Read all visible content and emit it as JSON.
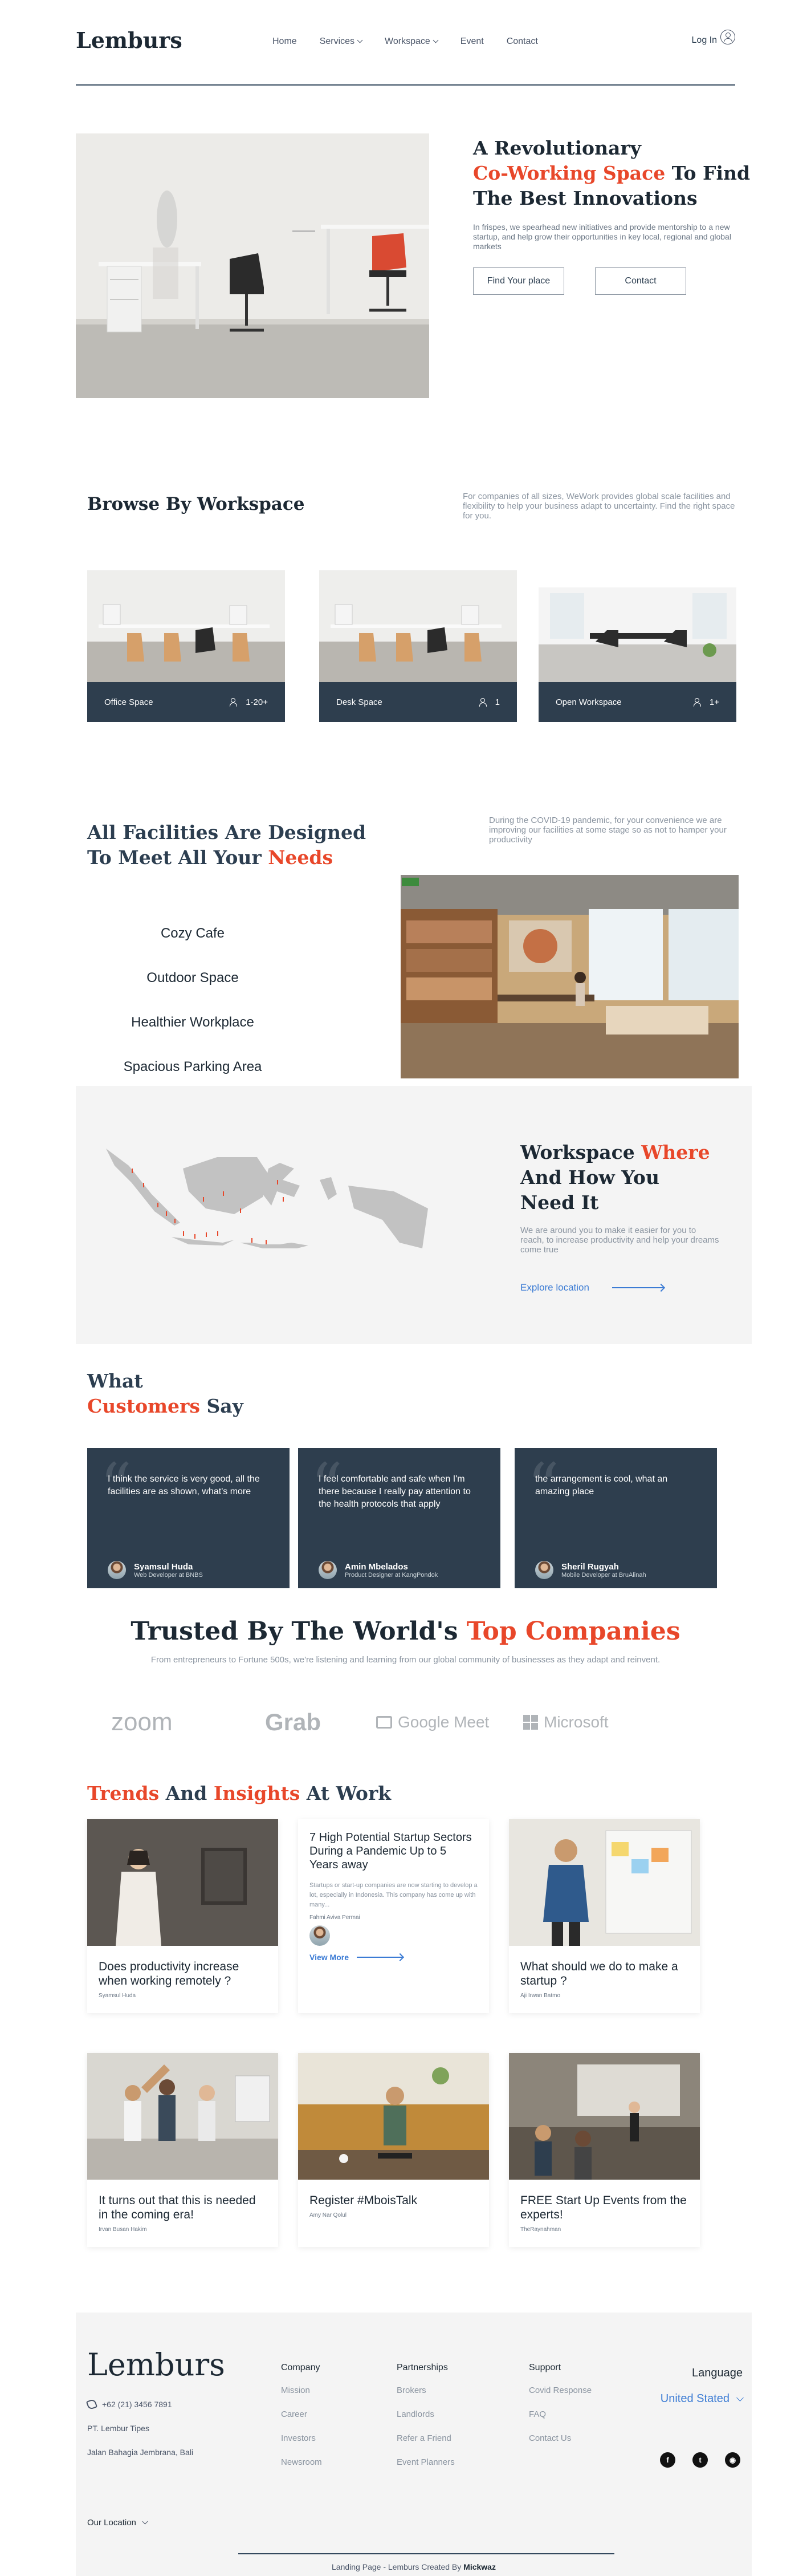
{
  "nav": {
    "logo": "Lemburs",
    "items": [
      "Home",
      "Services",
      "Workspace",
      "Event",
      "Contact"
    ],
    "login": "Log In"
  },
  "hero": {
    "title_1": "A Revolutionary",
    "title_accent": "Co-Working Space",
    "title_2": " To Find The Best Innovations",
    "subtitle": "In frispes, we spearhead new initiatives and provide mentorship to a new startup, and help grow their opportunities in key local, regional and global markets",
    "btn_primary": "Find Your place",
    "btn_secondary": "Contact"
  },
  "browse": {
    "title": "Browse By Workspace",
    "description": "For companies of all sizes, WeWork provides global scale facilities and flexibility to help your business adapt to uncertainty. Find the right space for you.",
    "cards": [
      {
        "name": "Office Space",
        "capacity": "1-20+"
      },
      {
        "name": "Desk Space",
        "capacity": "1"
      },
      {
        "name": "Open Workspace",
        "capacity": "1+"
      }
    ]
  },
  "facilities": {
    "title_1": "All Facilities Are Designed To Meet All Your ",
    "title_accent": "Needs",
    "description": "During the COVID-19 pandemic, for your convenience we are improving our facilities at some stage so as not to hamper your productivity",
    "items": [
      "Cozy Cafe",
      "Outdoor Space",
      "Healthier Workplace",
      "Spacious Parking Area"
    ]
  },
  "map": {
    "title_1": "Workspace ",
    "title_accent": "Where",
    "title_2": " And How You Need It",
    "subtitle": "We are around you to make it easier for you to reach, to increase productivity and help your dreams come true",
    "link": "Explore location"
  },
  "customers": {
    "title_1": "What",
    "title_accent": "Customers",
    "title_2": " Say",
    "testimonials": [
      {
        "quote": "I think the service is very good, all the facilities are as shown, what's more",
        "name": "Syamsul Huda",
        "role": "Web Developer at BNBS"
      },
      {
        "quote": "I feel comfortable and safe when I'm there because I really pay attention to the health protocols that apply",
        "name": "Amin Mbelados",
        "role": "Product Designer at KangPondok"
      },
      {
        "quote": "the arrangement is cool, what an amazing place",
        "name": "Sheril Rugyah",
        "role": "Mobile Developer at BruAlinah"
      }
    ]
  },
  "trusted": {
    "title_1": "Trusted By The World's ",
    "title_accent": "Top Companies",
    "subtitle": "From entrepreneurs to Fortune 500s, we're listening and learning from our global community of businesses as they adapt and reinvent.",
    "brands": [
      "zoom",
      "Grab",
      "Google Meet",
      "Microsoft"
    ]
  },
  "trends": {
    "title_accent_1": "Trends",
    "title_mid": " And ",
    "title_accent_2": "Insights",
    "title_end": " At Work",
    "featured": {
      "title": "7 High Potential Startup Sectors During a Pandemic Up to 5 Years away",
      "excerpt": "Startups or start-up companies are now starting to develop a lot, especially in Indonesia. This company has come up with many...",
      "author": "Fahmi Aviva Permai",
      "link": "View More"
    },
    "posts": [
      {
        "title": "Does productivity increase when working remotely ?",
        "author": "Syamsul Huda"
      },
      {
        "title": "What should we do to make a startup ?",
        "author": "Aji Irwan Batmo"
      },
      {
        "title": "It turns out that this is needed in the coming era!",
        "author": "Irvan Busan Hakim"
      },
      {
        "title": "Register #MboisTalk",
        "author": "Amy Nar Qolul"
      },
      {
        "title": "FREE Start Up Events from the experts!",
        "author": "TheRaynahman"
      }
    ]
  },
  "footer": {
    "logo": "Lemburs",
    "phone": "+62 (21) 3456 7891",
    "company_name": "PT. Lembur Tipes",
    "address": "Jalan Bahagia Jembrana, Bali",
    "columns": [
      {
        "title": "Company",
        "links": [
          "Mission",
          "Career",
          "Investors",
          "Newsroom"
        ]
      },
      {
        "title": "Partnerships",
        "links": [
          "Brokers",
          "Landlords",
          "Refer a Friend",
          "Event Planners"
        ]
      },
      {
        "title": "Support",
        "links": [
          "Covid Response",
          "FAQ",
          "Contact Us"
        ]
      }
    ],
    "language_label": "Language",
    "language_value": "United Stated",
    "location_label": "Our Location",
    "credit_prefix": "Landing Page - Lemburs Created By ",
    "credit_author": "Mickwaz"
  },
  "colors": {
    "accent": "#e8472a",
    "navy": "#2e3e4e",
    "link": "#3b7bd4"
  }
}
